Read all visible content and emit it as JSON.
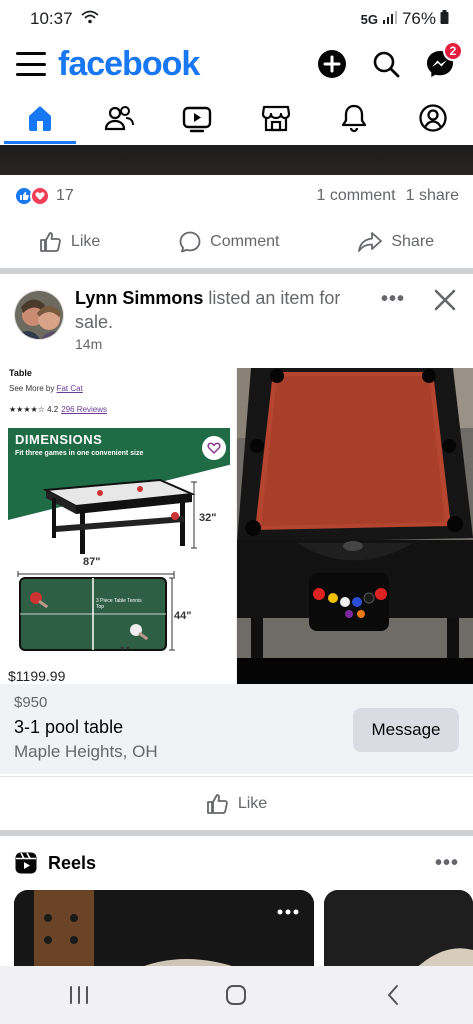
{
  "status_bar": {
    "time": "10:37",
    "network": "5G",
    "battery": "76%"
  },
  "header": {
    "logo": "facebook",
    "messenger_badge": "2"
  },
  "tabs": [
    {
      "name": "home",
      "active": true
    },
    {
      "name": "friends",
      "active": false
    },
    {
      "name": "video",
      "active": false
    },
    {
      "name": "marketplace",
      "active": false
    },
    {
      "name": "notifications",
      "active": false
    },
    {
      "name": "profile",
      "active": false
    }
  ],
  "prev_post": {
    "reaction_count": "17",
    "comments": "1 comment",
    "shares": "1 share",
    "like_label": "Like",
    "comment_label": "Comment",
    "share_label": "Share"
  },
  "post": {
    "author": "Lynn Simmons",
    "action_text": " listed an item for sale.",
    "time": "14m",
    "more": "•••"
  },
  "product_image": {
    "title": "Table",
    "seller_prefix": "See More by ",
    "seller": "Fat Cat",
    "stars": "★★★★☆",
    "rating": "4.2",
    "reviews": "296 Reviews",
    "dimensions_title": "DIMENSIONS",
    "dimensions_subtitle": "Fit three games in one convenient size",
    "height": "32\"",
    "length": "87\"",
    "width": "44\"",
    "ping_pong_label": "3 Piece Table Tennis Top",
    "price_peek": "$1199.99"
  },
  "listing": {
    "price": "$950",
    "title": "3-1 pool table",
    "location": "Maple Heights, OH",
    "message_label": "Message",
    "like_label": "Like"
  },
  "reels": {
    "title": "Reels",
    "more": "•••"
  },
  "colors": {
    "brand": "#1877f2",
    "badge": "#e41e3f",
    "felt": "#b5452f",
    "banner": "#1f6b45"
  }
}
